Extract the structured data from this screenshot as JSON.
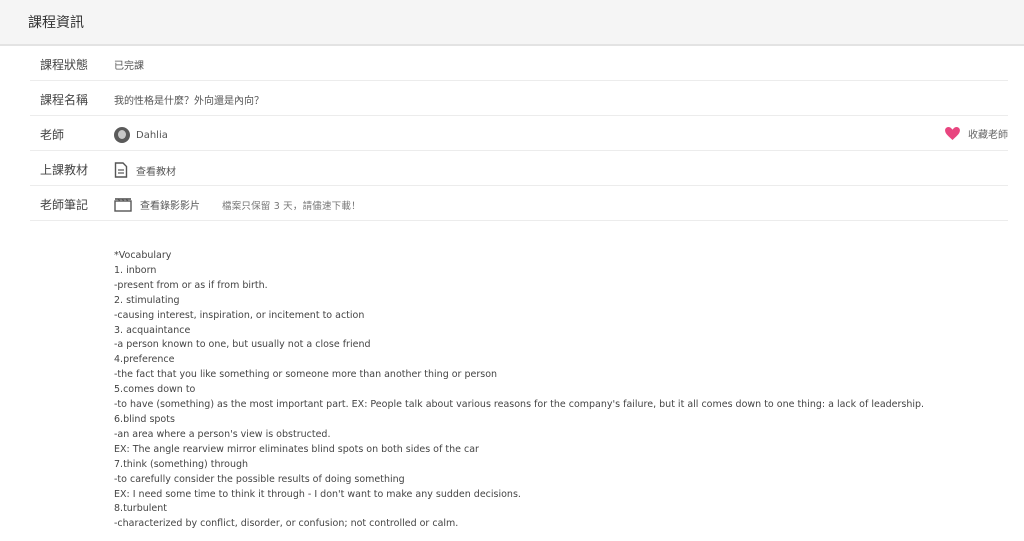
{
  "header": {
    "title": "課程資訊"
  },
  "rows": {
    "status": {
      "label": "課程狀態",
      "value": "已完課"
    },
    "name": {
      "label": "課程名稱",
      "value": "我的性格是什麼？外向還是內向？"
    },
    "teacher": {
      "label": "老師",
      "value": "Dahlia",
      "favorite_label": "收藏老師"
    },
    "material": {
      "label": "上課教材",
      "value": "查看教材"
    },
    "notes": {
      "label": "老師筆記",
      "value": "查看錄影影片",
      "hint": "檔案只保留 3 天，請儘速下載！"
    }
  },
  "notes_lines": [
    "*Vocabulary",
    "1. inborn",
    "-present from or as if from birth.",
    "2. stimulating",
    "-causing interest, inspiration, or incitement to action",
    "3. acquaintance",
    "-a person known to one, but usually not a close friend",
    "4.preference",
    "-the fact that you like something or someone more than another thing or person",
    "5.comes down to",
    "-to have (something) as the most important part. EX: People talk about various reasons for the company's failure, but it all comes down to one thing: a lack of leadership.",
    "6.blind spots",
    "-an area where a person's view is obstructed.",
    "EX: The angle rearview mirror eliminates blind spots on both sides of the car",
    "7.think (something) through",
    "-to carefully consider the possible results of doing something",
    "EX: I need some time to think it through - I don't want to make any sudden decisions.",
    "8.turbulent",
    "-characterized by conflict, disorder, or confusion; not controlled or calm."
  ],
  "colors": {
    "heart": "#e8457f",
    "header_bg": "#f5f5f5"
  }
}
